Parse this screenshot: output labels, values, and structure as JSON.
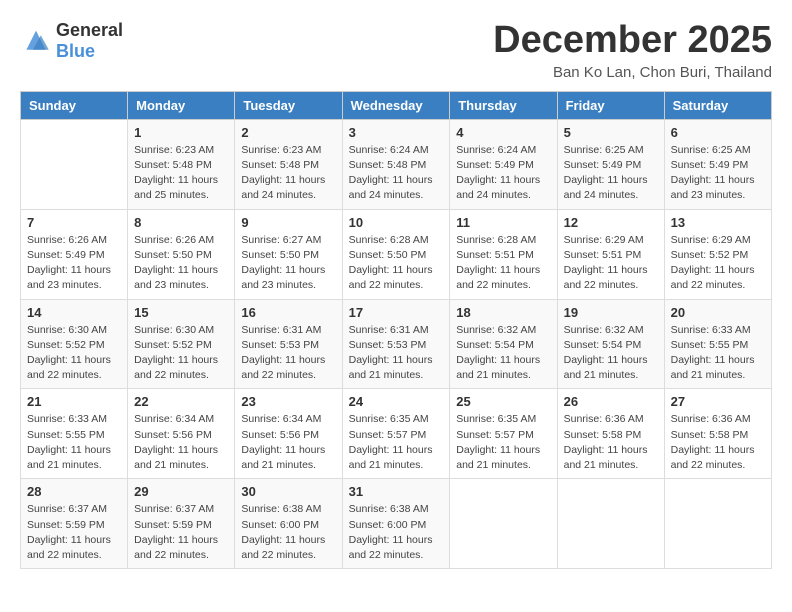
{
  "logo": {
    "text_general": "General",
    "text_blue": "Blue"
  },
  "header": {
    "month_title": "December 2025",
    "subtitle": "Ban Ko Lan, Chon Buri, Thailand"
  },
  "weekdays": [
    "Sunday",
    "Monday",
    "Tuesday",
    "Wednesday",
    "Thursday",
    "Friday",
    "Saturday"
  ],
  "weeks": [
    [
      {
        "day": "",
        "sunrise": "",
        "sunset": "",
        "daylight": ""
      },
      {
        "day": "1",
        "sunrise": "Sunrise: 6:23 AM",
        "sunset": "Sunset: 5:48 PM",
        "daylight": "Daylight: 11 hours and 25 minutes."
      },
      {
        "day": "2",
        "sunrise": "Sunrise: 6:23 AM",
        "sunset": "Sunset: 5:48 PM",
        "daylight": "Daylight: 11 hours and 24 minutes."
      },
      {
        "day": "3",
        "sunrise": "Sunrise: 6:24 AM",
        "sunset": "Sunset: 5:48 PM",
        "daylight": "Daylight: 11 hours and 24 minutes."
      },
      {
        "day": "4",
        "sunrise": "Sunrise: 6:24 AM",
        "sunset": "Sunset: 5:49 PM",
        "daylight": "Daylight: 11 hours and 24 minutes."
      },
      {
        "day": "5",
        "sunrise": "Sunrise: 6:25 AM",
        "sunset": "Sunset: 5:49 PM",
        "daylight": "Daylight: 11 hours and 24 minutes."
      },
      {
        "day": "6",
        "sunrise": "Sunrise: 6:25 AM",
        "sunset": "Sunset: 5:49 PM",
        "daylight": "Daylight: 11 hours and 23 minutes."
      }
    ],
    [
      {
        "day": "7",
        "sunrise": "Sunrise: 6:26 AM",
        "sunset": "Sunset: 5:49 PM",
        "daylight": "Daylight: 11 hours and 23 minutes."
      },
      {
        "day": "8",
        "sunrise": "Sunrise: 6:26 AM",
        "sunset": "Sunset: 5:50 PM",
        "daylight": "Daylight: 11 hours and 23 minutes."
      },
      {
        "day": "9",
        "sunrise": "Sunrise: 6:27 AM",
        "sunset": "Sunset: 5:50 PM",
        "daylight": "Daylight: 11 hours and 23 minutes."
      },
      {
        "day": "10",
        "sunrise": "Sunrise: 6:28 AM",
        "sunset": "Sunset: 5:50 PM",
        "daylight": "Daylight: 11 hours and 22 minutes."
      },
      {
        "day": "11",
        "sunrise": "Sunrise: 6:28 AM",
        "sunset": "Sunset: 5:51 PM",
        "daylight": "Daylight: 11 hours and 22 minutes."
      },
      {
        "day": "12",
        "sunrise": "Sunrise: 6:29 AM",
        "sunset": "Sunset: 5:51 PM",
        "daylight": "Daylight: 11 hours and 22 minutes."
      },
      {
        "day": "13",
        "sunrise": "Sunrise: 6:29 AM",
        "sunset": "Sunset: 5:52 PM",
        "daylight": "Daylight: 11 hours and 22 minutes."
      }
    ],
    [
      {
        "day": "14",
        "sunrise": "Sunrise: 6:30 AM",
        "sunset": "Sunset: 5:52 PM",
        "daylight": "Daylight: 11 hours and 22 minutes."
      },
      {
        "day": "15",
        "sunrise": "Sunrise: 6:30 AM",
        "sunset": "Sunset: 5:52 PM",
        "daylight": "Daylight: 11 hours and 22 minutes."
      },
      {
        "day": "16",
        "sunrise": "Sunrise: 6:31 AM",
        "sunset": "Sunset: 5:53 PM",
        "daylight": "Daylight: 11 hours and 22 minutes."
      },
      {
        "day": "17",
        "sunrise": "Sunrise: 6:31 AM",
        "sunset": "Sunset: 5:53 PM",
        "daylight": "Daylight: 11 hours and 21 minutes."
      },
      {
        "day": "18",
        "sunrise": "Sunrise: 6:32 AM",
        "sunset": "Sunset: 5:54 PM",
        "daylight": "Daylight: 11 hours and 21 minutes."
      },
      {
        "day": "19",
        "sunrise": "Sunrise: 6:32 AM",
        "sunset": "Sunset: 5:54 PM",
        "daylight": "Daylight: 11 hours and 21 minutes."
      },
      {
        "day": "20",
        "sunrise": "Sunrise: 6:33 AM",
        "sunset": "Sunset: 5:55 PM",
        "daylight": "Daylight: 11 hours and 21 minutes."
      }
    ],
    [
      {
        "day": "21",
        "sunrise": "Sunrise: 6:33 AM",
        "sunset": "Sunset: 5:55 PM",
        "daylight": "Daylight: 11 hours and 21 minutes."
      },
      {
        "day": "22",
        "sunrise": "Sunrise: 6:34 AM",
        "sunset": "Sunset: 5:56 PM",
        "daylight": "Daylight: 11 hours and 21 minutes."
      },
      {
        "day": "23",
        "sunrise": "Sunrise: 6:34 AM",
        "sunset": "Sunset: 5:56 PM",
        "daylight": "Daylight: 11 hours and 21 minutes."
      },
      {
        "day": "24",
        "sunrise": "Sunrise: 6:35 AM",
        "sunset": "Sunset: 5:57 PM",
        "daylight": "Daylight: 11 hours and 21 minutes."
      },
      {
        "day": "25",
        "sunrise": "Sunrise: 6:35 AM",
        "sunset": "Sunset: 5:57 PM",
        "daylight": "Daylight: 11 hours and 21 minutes."
      },
      {
        "day": "26",
        "sunrise": "Sunrise: 6:36 AM",
        "sunset": "Sunset: 5:58 PM",
        "daylight": "Daylight: 11 hours and 21 minutes."
      },
      {
        "day": "27",
        "sunrise": "Sunrise: 6:36 AM",
        "sunset": "Sunset: 5:58 PM",
        "daylight": "Daylight: 11 hours and 22 minutes."
      }
    ],
    [
      {
        "day": "28",
        "sunrise": "Sunrise: 6:37 AM",
        "sunset": "Sunset: 5:59 PM",
        "daylight": "Daylight: 11 hours and 22 minutes."
      },
      {
        "day": "29",
        "sunrise": "Sunrise: 6:37 AM",
        "sunset": "Sunset: 5:59 PM",
        "daylight": "Daylight: 11 hours and 22 minutes."
      },
      {
        "day": "30",
        "sunrise": "Sunrise: 6:38 AM",
        "sunset": "Sunset: 6:00 PM",
        "daylight": "Daylight: 11 hours and 22 minutes."
      },
      {
        "day": "31",
        "sunrise": "Sunrise: 6:38 AM",
        "sunset": "Sunset: 6:00 PM",
        "daylight": "Daylight: 11 hours and 22 minutes."
      },
      {
        "day": "",
        "sunrise": "",
        "sunset": "",
        "daylight": ""
      },
      {
        "day": "",
        "sunrise": "",
        "sunset": "",
        "daylight": ""
      },
      {
        "day": "",
        "sunrise": "",
        "sunset": "",
        "daylight": ""
      }
    ]
  ]
}
